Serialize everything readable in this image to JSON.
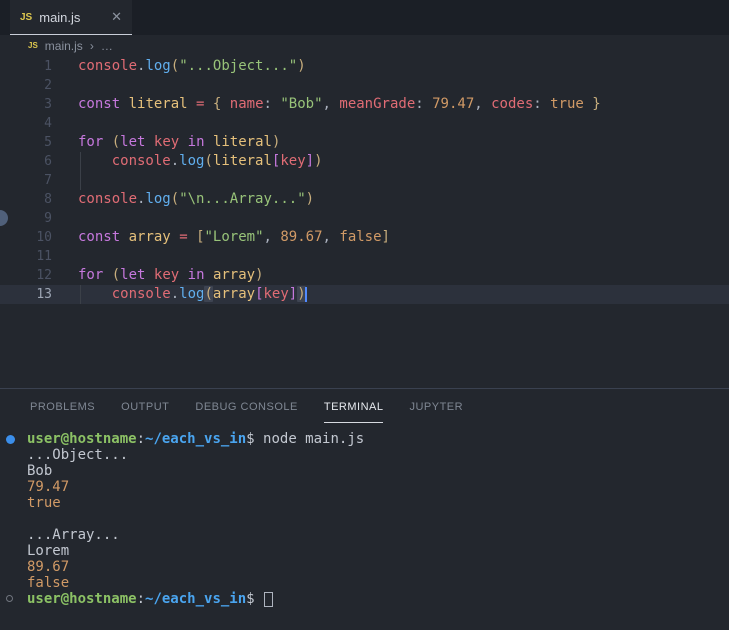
{
  "colors": {
    "editor_bg": "#23272e",
    "tabstrip_bg": "#1b1f26",
    "active_line_bg": "#2c313c",
    "keyword": "#c678dd",
    "variable": "#e5c07b",
    "property": "#e06c75",
    "string": "#98c379",
    "number": "#d19a66",
    "function": "#61afef",
    "bracket_l1": "#c8ae7d",
    "bracket_l2": "#c678dd",
    "cursor": "#528bff",
    "prompt_user": "#8cc265",
    "prompt_path": "#4aa5f0",
    "command_dot": "#3b8eea",
    "js_icon": "#ddc74e"
  },
  "tab_bar": {
    "tab": {
      "icon_label": "JS",
      "title": "main.js",
      "close_glyph": "✕"
    }
  },
  "breadcrumb": {
    "icon_label": "JS",
    "file": "main.js",
    "separator": "›",
    "ellipsis": "…"
  },
  "editor": {
    "lines": [
      {
        "n": 1,
        "tokens": [
          [
            "console",
            "red"
          ],
          [
            ".",
            "fg"
          ],
          [
            "log",
            "blue"
          ],
          [
            "(",
            "gold"
          ],
          [
            "\"...Object...\"",
            "green"
          ],
          [
            ")",
            "gold"
          ]
        ]
      },
      {
        "n": 2,
        "tokens": []
      },
      {
        "n": 3,
        "tokens": [
          [
            "const",
            "purple"
          ],
          [
            " ",
            "fg"
          ],
          [
            "literal",
            "yellow"
          ],
          [
            " ",
            "fg"
          ],
          [
            "=",
            "red"
          ],
          [
            " ",
            "fg"
          ],
          [
            "{",
            "gold"
          ],
          [
            " ",
            "fg"
          ],
          [
            "name",
            "red"
          ],
          [
            ": ",
            "fg"
          ],
          [
            "\"Bob\"",
            "green"
          ],
          [
            ", ",
            "fg"
          ],
          [
            "meanGrade",
            "red"
          ],
          [
            ": ",
            "fg"
          ],
          [
            "79.47",
            "orange"
          ],
          [
            ", ",
            "fg"
          ],
          [
            "codes",
            "red"
          ],
          [
            ": ",
            "fg"
          ],
          [
            "true",
            "orange"
          ],
          [
            " ",
            "fg"
          ],
          [
            "}",
            "gold"
          ]
        ]
      },
      {
        "n": 4,
        "tokens": []
      },
      {
        "n": 5,
        "tokens": [
          [
            "for",
            "purple"
          ],
          [
            " ",
            "fg"
          ],
          [
            "(",
            "gold"
          ],
          [
            "let",
            "purple"
          ],
          [
            " ",
            "fg"
          ],
          [
            "key",
            "red"
          ],
          [
            " ",
            "fg"
          ],
          [
            "in",
            "purple"
          ],
          [
            " ",
            "fg"
          ],
          [
            "literal",
            "yellow"
          ],
          [
            ")",
            "gold"
          ]
        ]
      },
      {
        "n": 6,
        "guide": true,
        "tokens": [
          [
            "    ",
            "fg"
          ],
          [
            "console",
            "red"
          ],
          [
            ".",
            "fg"
          ],
          [
            "log",
            "blue"
          ],
          [
            "(",
            "gold"
          ],
          [
            "literal",
            "yellow"
          ],
          [
            "[",
            "purple"
          ],
          [
            "key",
            "red"
          ],
          [
            "]",
            "purple"
          ],
          [
            ")",
            "gold"
          ]
        ]
      },
      {
        "n": 7,
        "guide": true,
        "tokens": []
      },
      {
        "n": 8,
        "tokens": [
          [
            "console",
            "red"
          ],
          [
            ".",
            "fg"
          ],
          [
            "log",
            "blue"
          ],
          [
            "(",
            "gold"
          ],
          [
            "\"\\n...Array...\"",
            "green"
          ],
          [
            ")",
            "gold"
          ]
        ]
      },
      {
        "n": 9,
        "tokens": []
      },
      {
        "n": 10,
        "tokens": [
          [
            "const",
            "purple"
          ],
          [
            " ",
            "fg"
          ],
          [
            "array",
            "yellow"
          ],
          [
            " ",
            "fg"
          ],
          [
            "=",
            "red"
          ],
          [
            " ",
            "fg"
          ],
          [
            "[",
            "gold"
          ],
          [
            "\"Lorem\"",
            "green"
          ],
          [
            ", ",
            "fg"
          ],
          [
            "89.67",
            "orange"
          ],
          [
            ", ",
            "fg"
          ],
          [
            "false",
            "orange"
          ],
          [
            "]",
            "gold"
          ]
        ]
      },
      {
        "n": 11,
        "tokens": []
      },
      {
        "n": 12,
        "tokens": [
          [
            "for",
            "purple"
          ],
          [
            " ",
            "fg"
          ],
          [
            "(",
            "gold"
          ],
          [
            "let",
            "purple"
          ],
          [
            " ",
            "fg"
          ],
          [
            "key",
            "red"
          ],
          [
            " ",
            "fg"
          ],
          [
            "in",
            "purple"
          ],
          [
            " ",
            "fg"
          ],
          [
            "array",
            "yellow"
          ],
          [
            ")",
            "gold"
          ]
        ]
      },
      {
        "n": 13,
        "active": true,
        "guide": true,
        "cursor": true,
        "tokens": [
          [
            "    ",
            "fg"
          ],
          [
            "console",
            "red"
          ],
          [
            ".",
            "fg"
          ],
          [
            "log",
            "blue"
          ],
          [
            "(",
            "gold match"
          ],
          [
            "array",
            "yellow"
          ],
          [
            "[",
            "purple"
          ],
          [
            "key",
            "red"
          ],
          [
            "]",
            "purple"
          ],
          [
            ")",
            "gold match"
          ]
        ]
      }
    ]
  },
  "panel": {
    "tabs": [
      {
        "label": "PROBLEMS",
        "active": false
      },
      {
        "label": "OUTPUT",
        "active": false
      },
      {
        "label": "DEBUG CONSOLE",
        "active": false
      },
      {
        "label": "TERMINAL",
        "active": true
      },
      {
        "label": "JUPYTER",
        "active": false
      }
    ],
    "terminal": {
      "lines": [
        {
          "deco": "dot",
          "tokens": [
            [
              "user@hostname",
              "green"
            ],
            [
              ":",
              "fg"
            ],
            [
              "~/each_vs_in",
              "blue"
            ],
            [
              "$",
              "fg"
            ],
            [
              " node main.js",
              "fg"
            ]
          ]
        },
        {
          "tokens": [
            [
              "...Object...",
              "fg"
            ]
          ]
        },
        {
          "tokens": [
            [
              "Bob",
              "fg"
            ]
          ]
        },
        {
          "tokens": [
            [
              "79.47",
              "orange"
            ]
          ]
        },
        {
          "tokens": [
            [
              "true",
              "orange"
            ]
          ]
        },
        {
          "tokens": []
        },
        {
          "tokens": [
            [
              "...Array...",
              "fg"
            ]
          ]
        },
        {
          "tokens": [
            [
              "Lorem",
              "fg"
            ]
          ]
        },
        {
          "tokens": [
            [
              "89.67",
              "orange"
            ]
          ]
        },
        {
          "tokens": [
            [
              "false",
              "orange"
            ]
          ]
        },
        {
          "deco": "circle",
          "cursor": true,
          "tokens": [
            [
              "user@hostname",
              "green"
            ],
            [
              ":",
              "fg"
            ],
            [
              "~/each_vs_in",
              "blue"
            ],
            [
              "$",
              "fg"
            ],
            [
              " ",
              "fg"
            ]
          ]
        }
      ]
    }
  }
}
